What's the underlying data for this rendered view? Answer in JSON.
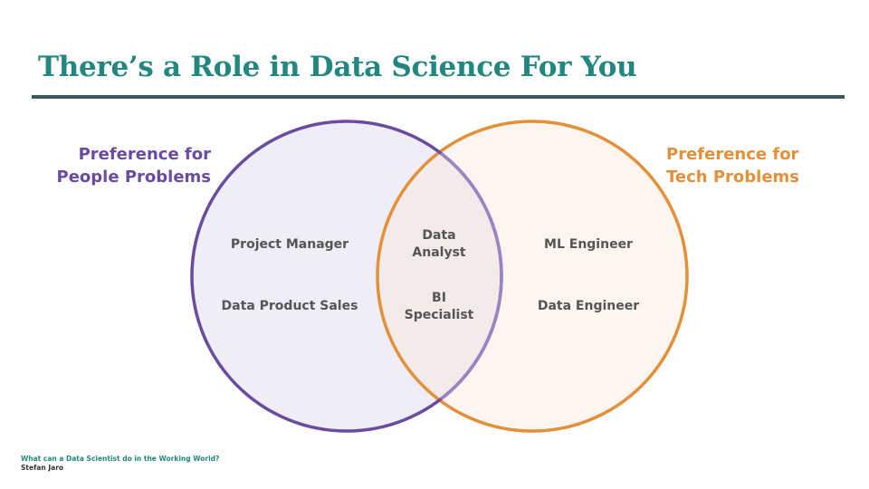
{
  "title": "There’s a Role in Data Science For You",
  "labels": {
    "left_line1": "Preference for",
    "left_line2": "People Problems",
    "right_line1": "Preference for",
    "right_line2": "Tech Problems"
  },
  "roles": {
    "people": [
      "Project Manager",
      "Data Product Sales"
    ],
    "overlap": [
      [
        "Data",
        "Analyst"
      ],
      [
        "BI",
        "Specialist"
      ]
    ],
    "tech": [
      "ML Engineer",
      "Data Engineer"
    ]
  },
  "footer": {
    "subtitle": "What can a Data Scientist do in the Working World?",
    "author": "Stefan Jaro"
  },
  "colors": {
    "title": "#21877f",
    "rule": "#3a5a5e",
    "people": "#6a4ba0",
    "people_fill": "#efedf7",
    "tech": "#e39038",
    "tech_fill": "#fdf5ef",
    "overlap_fill": "#f3eaea",
    "role_text": "#555555"
  }
}
